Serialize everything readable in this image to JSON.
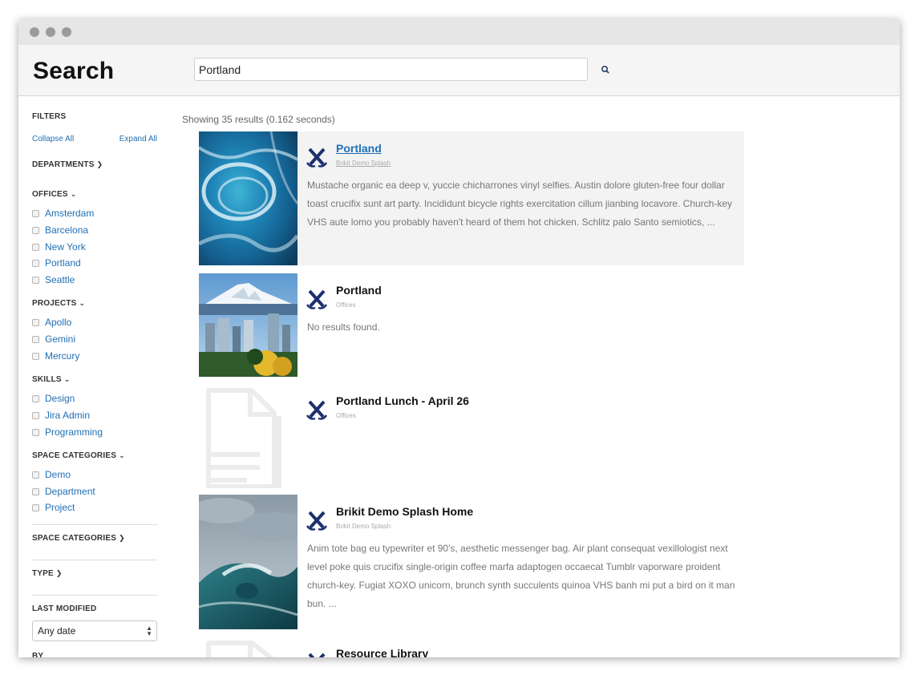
{
  "header": {
    "title": "Search",
    "search_value": "Portland",
    "search_icon": "search-icon"
  },
  "sidebar": {
    "filters_label": "FILTERS",
    "collapse_all": "Collapse All",
    "expand_all": "Expand All",
    "departments": "DEPARTMENTS",
    "offices": {
      "label": "OFFICES",
      "items": [
        "Amsterdam",
        "Barcelona",
        "New York",
        "Portland",
        "Seattle"
      ]
    },
    "projects": {
      "label": "PROJECTS",
      "items": [
        "Apollo",
        "Gemini",
        "Mercury"
      ]
    },
    "skills": {
      "label": "SKILLS",
      "items": [
        "Design",
        "Jira Admin",
        "Programming"
      ]
    },
    "space_categories_open": {
      "label": "SPACE CATEGORIES",
      "items": [
        "Demo",
        "Department",
        "Project"
      ]
    },
    "space_categories_closed": "SPACE CATEGORIES",
    "type": "TYPE",
    "last_modified": {
      "label": "LAST MODIFIED",
      "selected": "Any date"
    },
    "by_label": "BY"
  },
  "results": {
    "count_text": "Showing 35 results (0.162 seconds)",
    "items": [
      {
        "title": "Portland",
        "space": "Brikit Demo Splash",
        "excerpt": "Mustache organic ea deep v, yuccie chicharrones vinyl selfies. Austin dolore gluten-free four dollar toast crucifix sunt art party. Incididunt bicycle rights exercitation cillum jianbing locavore. Church-key VHS aute lomo you probably haven't heard of them hot chicken. Schlitz palo Santo semiotics, ..."
      },
      {
        "title": "Portland",
        "space": "Offices",
        "excerpt": "No results found."
      },
      {
        "title": "Portland Lunch - April 26",
        "space": "Offices",
        "excerpt": ""
      },
      {
        "title": "Brikit Demo Splash Home",
        "space": "Brikit Demo Splash",
        "excerpt": "Anim tote bag eu typewriter et 90's, aesthetic messenger bag. Air plant consequat vexillologist next level poke quis crucifix single-origin coffee marfa adaptogen occaecat Tumblr vaporware proident church-key. Fugiat XOXO unicorn, brunch synth succulents quinoa VHS banh mi put a bird on it man bun. ..."
      },
      {
        "title": "Resource Library",
        "space": "",
        "excerpt": ""
      }
    ]
  },
  "colors": {
    "link": "#1f6fb5",
    "logo_navy": "#1d2f6e",
    "highlight_bg": "#f3f3f3"
  }
}
